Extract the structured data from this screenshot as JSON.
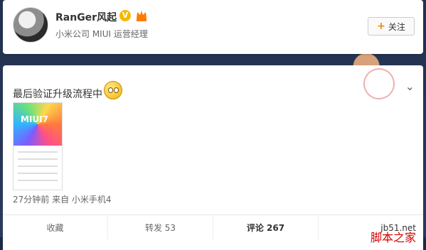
{
  "profile": {
    "name": "RanGer风起",
    "verified_badge": "V",
    "description": "小米公司 MIUI 运营经理",
    "follow_label": "关注"
  },
  "post": {
    "text": "最后验证升级流程中",
    "image_title": "MIUI7",
    "meta": "27分钟前 来自 小米手机4",
    "actions": {
      "collect": "收藏",
      "repost": "转发 53",
      "comment": "评论 267"
    }
  },
  "watermark": {
    "site": "jb51.net",
    "brand": "脚本之家"
  },
  "icons": {
    "follow": "plus-icon",
    "menu": "chevron-down-icon",
    "emoji": "grin-emoji-icon"
  }
}
